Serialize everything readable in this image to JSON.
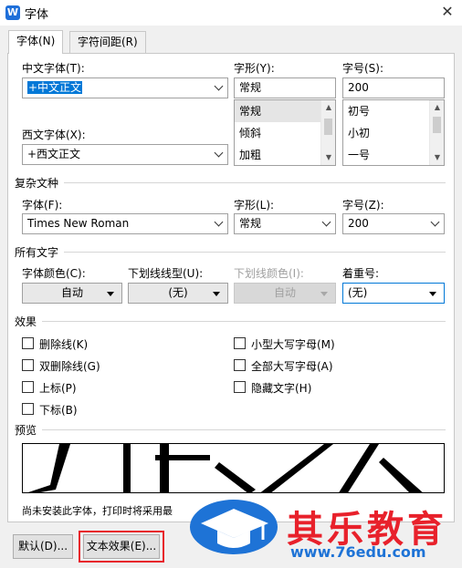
{
  "window": {
    "title": "字体",
    "app_icon": "W"
  },
  "tabs": [
    {
      "label": "字体(N)"
    },
    {
      "label": "字符间距(R)"
    }
  ],
  "chinese_font": {
    "label": "中文字体(T):",
    "value": "+中文正文"
  },
  "western_font": {
    "label": "西文字体(X):",
    "value": "+西文正文"
  },
  "style": {
    "label": "字形(Y):",
    "value": "常规",
    "options": [
      "常规",
      "倾斜",
      "加粗"
    ]
  },
  "size": {
    "label": "字号(S):",
    "value": "200",
    "options": [
      "初号",
      "小初",
      "一号"
    ]
  },
  "complex": {
    "section": "复杂文种",
    "font_label": "字体(F):",
    "font_value": "Times New Roman",
    "style_label": "字形(L):",
    "style_value": "常规",
    "size_label": "字号(Z):",
    "size_value": "200"
  },
  "all_text": {
    "section": "所有文字",
    "color_label": "字体颜色(C):",
    "color_value": "自动",
    "underline_label": "下划线线型(U):",
    "underline_value": "(无)",
    "underline_color_label": "下划线颜色(I):",
    "underline_color_value": "自动",
    "emphasis_label": "着重号:",
    "emphasis_value": "(无)"
  },
  "effects": {
    "section": "效果",
    "strikethrough": "删除线(K)",
    "double_strikethrough": "双删除线(G)",
    "superscript": "上标(P)",
    "subscript": "下标(B)",
    "small_caps": "小型大写字母(M)",
    "all_caps": "全部大写字母(A)",
    "hidden": "隐藏文字(H)"
  },
  "preview": {
    "section": "预览",
    "note": "尚未安装此字体，打印时将采用最"
  },
  "buttons": {
    "default": "默认(D)...",
    "text_effects": "文本效果(E)..."
  },
  "watermark": {
    "name": "其乐教育",
    "url": "www.76edu.com"
  },
  "colors": {
    "accent": "#0078d7",
    "highlight_box": "#e8212b",
    "watermark_blue": "#1e73d6",
    "watermark_red": "#e8212b"
  }
}
